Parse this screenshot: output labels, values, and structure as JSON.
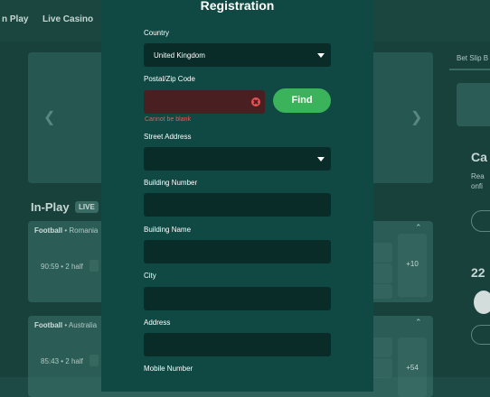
{
  "background": {
    "nav": [
      "n Play",
      "Live Casino"
    ],
    "in_play_label": "In-Play",
    "live_badge": "LIVE",
    "cards": [
      {
        "sport": "Football",
        "country": "Romania",
        "clock": "90:59 • 2 half",
        "more": "+10"
      },
      {
        "sport": "Football",
        "country": "Australia",
        "clock": "85:43 • 2 half",
        "more": "+54"
      }
    ],
    "right_panel": {
      "betslip": "Bet Slip B",
      "heading": "Ca",
      "text": "Rea onfi",
      "number": "22"
    }
  },
  "modal": {
    "title": "Registration",
    "country": {
      "label": "Country",
      "value": "United Kingdom"
    },
    "postal": {
      "label": "Postal/Zip Code",
      "value": "",
      "error": "Cannot be blank"
    },
    "find_button": "Find",
    "street": {
      "label": "Street Address",
      "value": ""
    },
    "building_number": {
      "label": "Building Number",
      "value": ""
    },
    "building_name": {
      "label": "Building Name",
      "value": ""
    },
    "city": {
      "label": "City",
      "value": ""
    },
    "address": {
      "label": "Address",
      "value": ""
    },
    "mobile": {
      "label": "Mobile Number"
    }
  },
  "colors": {
    "modal_bg": "#104843",
    "field_bg": "#0a2c29",
    "error_bg": "#4a1f22",
    "error_text": "#ea5a5a",
    "find_button": "#3bb35a"
  }
}
